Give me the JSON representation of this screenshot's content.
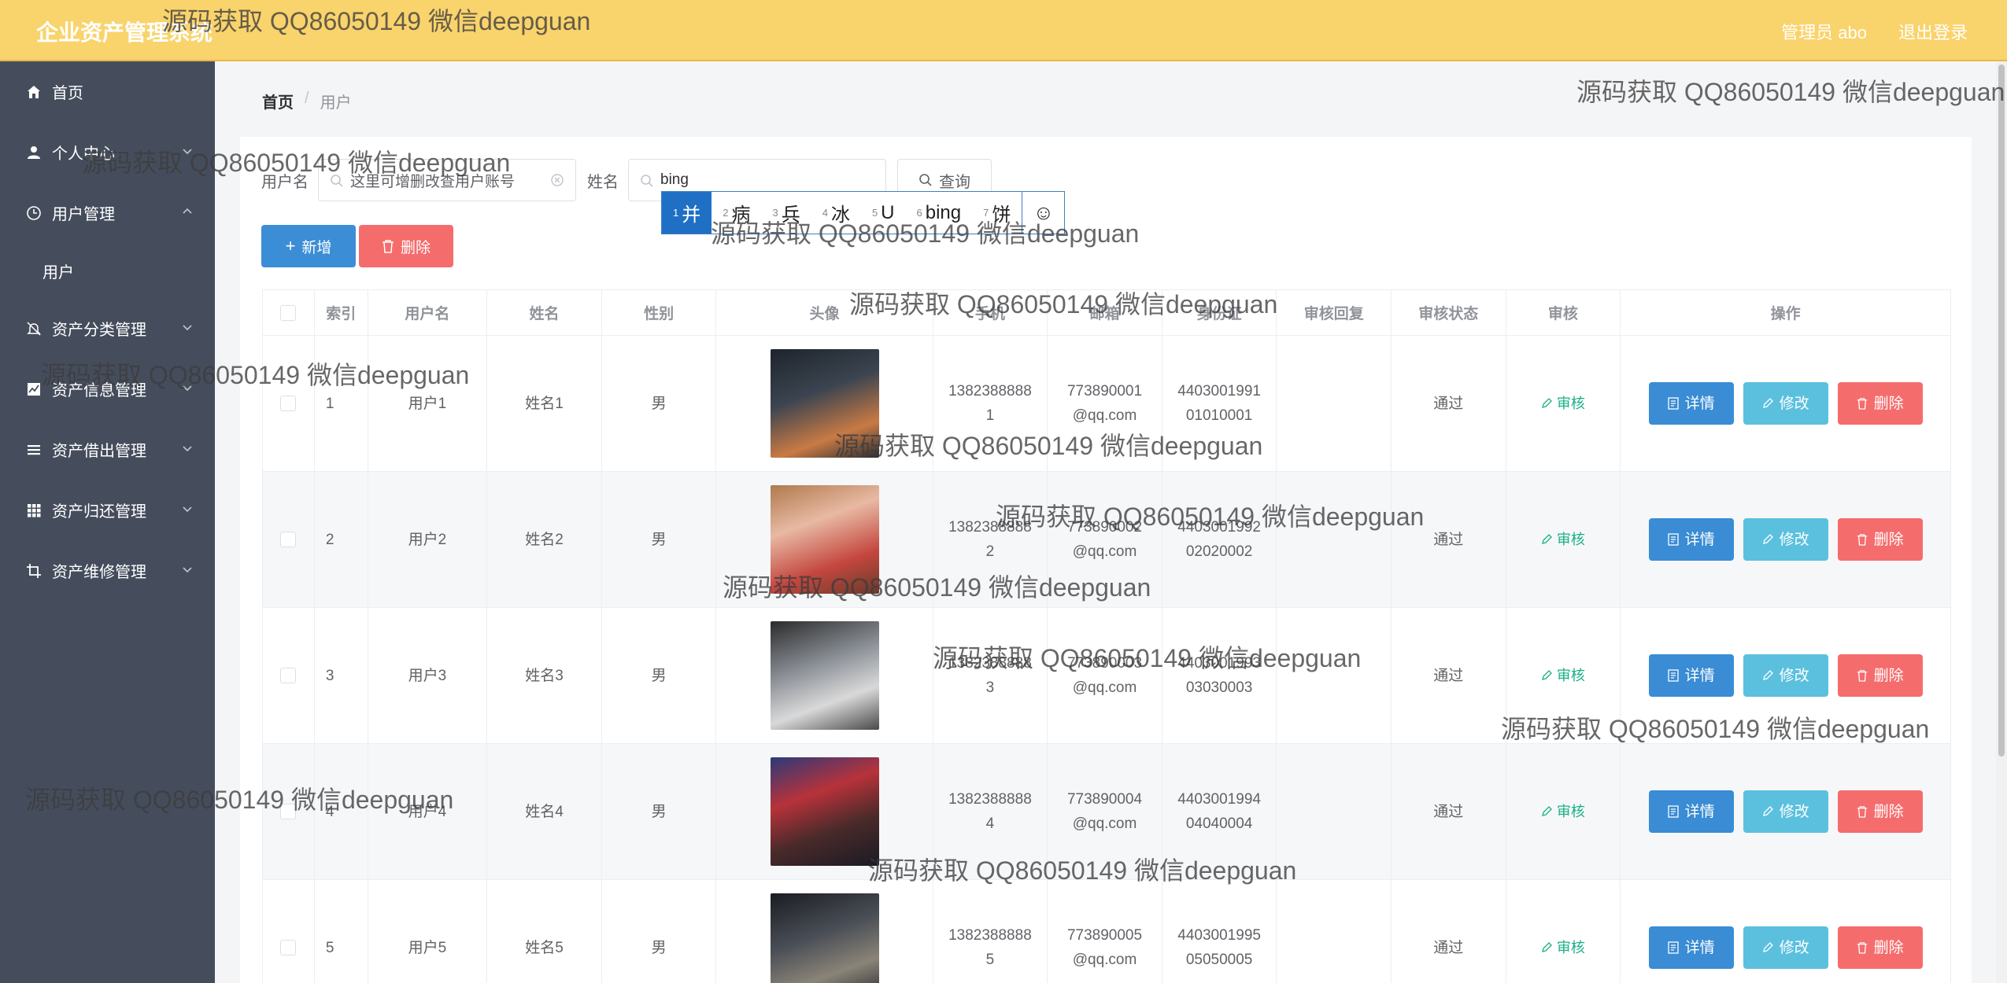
{
  "app": {
    "title": "企业资产管理系统"
  },
  "header": {
    "admin_label": "管理员 abo",
    "logout_label": "退出登录"
  },
  "sidebar": {
    "items": [
      {
        "label": "首页",
        "icon": "home-icon"
      },
      {
        "label": "个人中心",
        "icon": "user-icon"
      },
      {
        "label": "用户管理",
        "icon": "clock-icon",
        "expanded": true,
        "children": [
          "用户"
        ]
      },
      {
        "label": "资产分类管理",
        "icon": "bell-off-icon"
      },
      {
        "label": "资产信息管理",
        "icon": "chart-icon"
      },
      {
        "label": "资产借出管理",
        "icon": "menu-icon"
      },
      {
        "label": "资产归还管理",
        "icon": "grid-icon"
      },
      {
        "label": "资产维修管理",
        "icon": "crop-icon"
      }
    ]
  },
  "breadcrumb": {
    "home": "首页",
    "separator": "/",
    "current": "用户"
  },
  "search": {
    "username_label": "用户名",
    "username_placeholder": "这里可增删改查用户账号",
    "name_label": "姓名",
    "name_value": "bing",
    "query_label": "查询"
  },
  "ime": {
    "candidates": [
      {
        "num": "1",
        "text": "并"
      },
      {
        "num": "2",
        "text": "病"
      },
      {
        "num": "3",
        "text": "兵"
      },
      {
        "num": "4",
        "text": "冰"
      },
      {
        "num": "5",
        "text": "U"
      },
      {
        "num": "6",
        "text": "bing"
      },
      {
        "num": "7",
        "text": "饼"
      }
    ],
    "emoji": "☺"
  },
  "actions": {
    "add_label": "新增",
    "delete_label": "删除"
  },
  "table": {
    "headers": [
      "索引",
      "用户名",
      "姓名",
      "性别",
      "头像",
      "手机",
      "邮箱",
      "身份证",
      "审核回复",
      "审核状态",
      "审核",
      "操作"
    ],
    "audit_label": "审核",
    "detail_label": "详情",
    "edit_label": "修改",
    "remove_label": "删除",
    "rows": [
      {
        "index": "1",
        "username": "用户1",
        "name": "姓名1",
        "gender": "男",
        "phone": [
          "1382388888",
          "1"
        ],
        "email": [
          "773890001",
          "@qq.com"
        ],
        "idcard": [
          "4403001991",
          "01010001"
        ],
        "reply": "",
        "status": "通过"
      },
      {
        "index": "2",
        "username": "用户2",
        "name": "姓名2",
        "gender": "男",
        "phone": [
          "1382388888",
          "2"
        ],
        "email": [
          "773890002",
          "@qq.com"
        ],
        "idcard": [
          "4403001992",
          "02020002"
        ],
        "reply": "",
        "status": "通过"
      },
      {
        "index": "3",
        "username": "用户3",
        "name": "姓名3",
        "gender": "男",
        "phone": [
          "1382388888",
          "3"
        ],
        "email": [
          "773890003",
          "@qq.com"
        ],
        "idcard": [
          "4403001993",
          "03030003"
        ],
        "reply": "",
        "status": "通过"
      },
      {
        "index": "4",
        "username": "用户4",
        "name": "姓名4",
        "gender": "男",
        "phone": [
          "1382388888",
          "4"
        ],
        "email": [
          "773890004",
          "@qq.com"
        ],
        "idcard": [
          "4403001994",
          "04040004"
        ],
        "reply": "",
        "status": "通过"
      },
      {
        "index": "5",
        "username": "用户5",
        "name": "姓名5",
        "gender": "男",
        "phone": [
          "1382388888",
          "5"
        ],
        "email": [
          "773890005",
          "@qq.com"
        ],
        "idcard": [
          "4403001995",
          "05050005"
        ],
        "reply": "",
        "status": "通过"
      }
    ]
  },
  "watermark": {
    "text": "源码获取 QQ86050149 微信deepguan"
  },
  "colors": {
    "header_bg": "#f9d36c",
    "sidebar_bg": "#454d5d",
    "primary": "#3b8ed6",
    "danger": "#f56c6c",
    "info": "#5bc0de",
    "success": "#1aaf86"
  }
}
